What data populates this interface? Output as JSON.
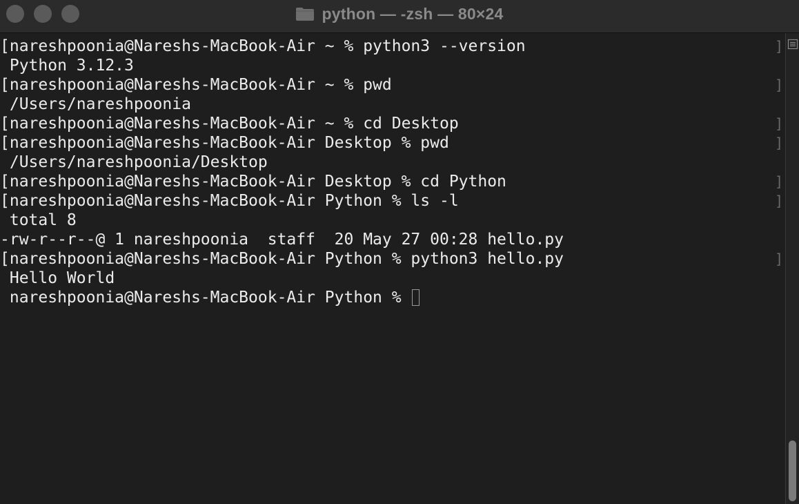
{
  "window": {
    "title": "python — -zsh — 80×24"
  },
  "terminal": {
    "lines": [
      "[nareshpoonia@Nareshs-MacBook-Air ~ % python3 --version",
      " Python 3.12.3",
      "[nareshpoonia@Nareshs-MacBook-Air ~ % pwd",
      " /Users/nareshpoonia",
      "[nareshpoonia@Nareshs-MacBook-Air ~ % cd Desktop",
      "[nareshpoonia@Nareshs-MacBook-Air Desktop % pwd",
      " /Users/nareshpoonia/Desktop",
      "[nareshpoonia@Nareshs-MacBook-Air Desktop % cd Python",
      "[nareshpoonia@Nareshs-MacBook-Air Python % ls -l",
      " total 8",
      "-rw-r--r--@ 1 nareshpoonia  staff  20 May 27 00:28 hello.py",
      "[nareshpoonia@Nareshs-MacBook-Air Python % python3 hello.py",
      " Hello World",
      " nareshpoonia@Nareshs-MacBook-Air Python % "
    ],
    "right_bracket": "]"
  },
  "icons": {
    "folder": "folder-icon",
    "scroll": "scroll-lines-icon"
  },
  "colors": {
    "background": "#1e1e1e",
    "text": "#ececec",
    "titlebar": "#2b2b2b"
  }
}
